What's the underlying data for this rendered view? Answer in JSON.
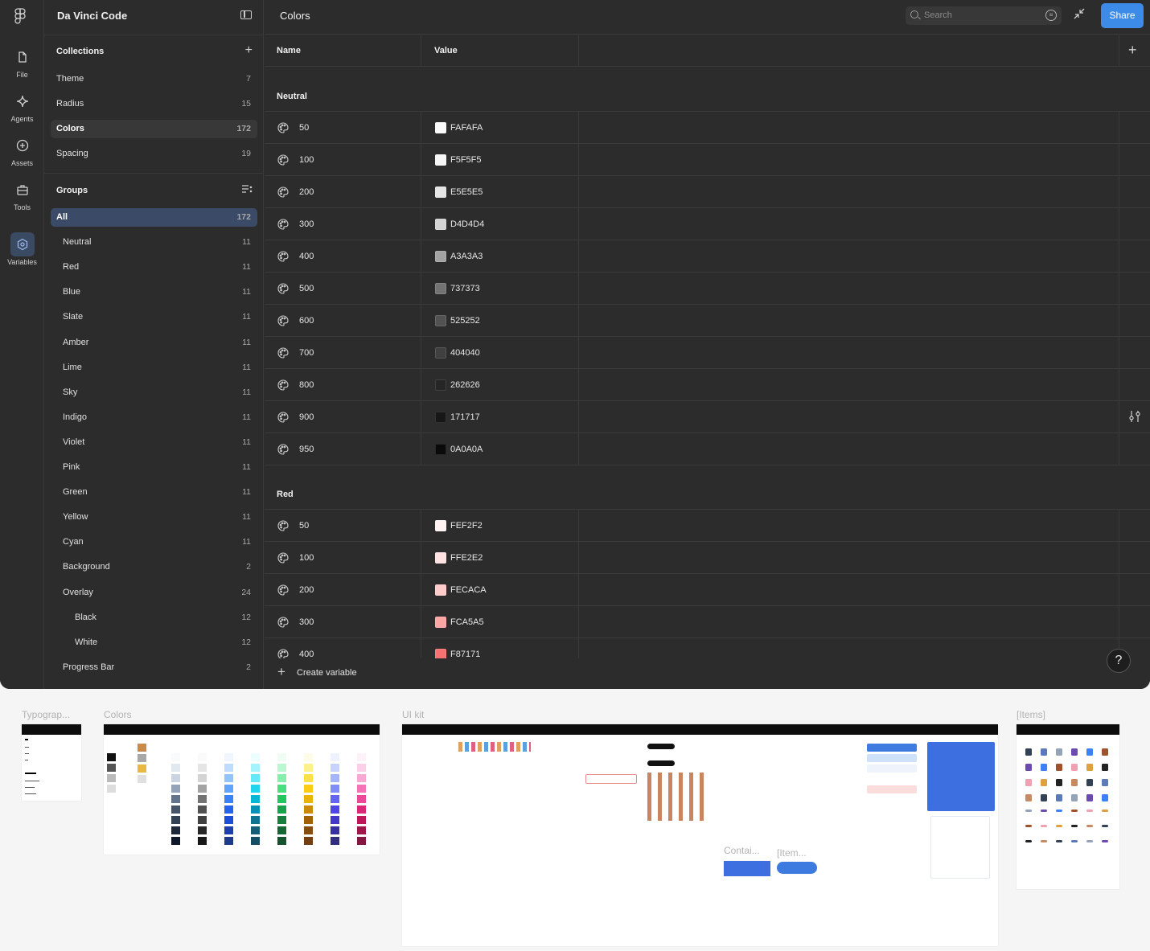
{
  "app": {
    "title": "Da Vinci Code"
  },
  "rail": {
    "items": [
      {
        "label": "File",
        "icon": "file-icon"
      },
      {
        "label": "Agents",
        "icon": "agents-icon"
      },
      {
        "label": "Assets",
        "icon": "plus-circle-icon"
      },
      {
        "label": "Tools",
        "icon": "toolbox-icon"
      },
      {
        "label": "Variables",
        "icon": "variables-icon",
        "active": true
      }
    ]
  },
  "collections": {
    "header": "Collections",
    "items": [
      {
        "name": "Theme",
        "count": "7"
      },
      {
        "name": "Radius",
        "count": "15"
      },
      {
        "name": "Colors",
        "count": "172",
        "selected": true
      },
      {
        "name": "Spacing",
        "count": "19"
      }
    ]
  },
  "groups": {
    "header": "Groups",
    "items": [
      {
        "name": "All",
        "count": "172",
        "selected": true,
        "indent": 0
      },
      {
        "name": "Neutral",
        "count": "11",
        "indent": 1
      },
      {
        "name": "Red",
        "count": "11",
        "indent": 1
      },
      {
        "name": "Blue",
        "count": "11",
        "indent": 1
      },
      {
        "name": "Slate",
        "count": "11",
        "indent": 1
      },
      {
        "name": "Amber",
        "count": "11",
        "indent": 1
      },
      {
        "name": "Lime",
        "count": "11",
        "indent": 1
      },
      {
        "name": "Sky",
        "count": "11",
        "indent": 1
      },
      {
        "name": "Indigo",
        "count": "11",
        "indent": 1
      },
      {
        "name": "Violet",
        "count": "11",
        "indent": 1
      },
      {
        "name": "Pink",
        "count": "11",
        "indent": 1
      },
      {
        "name": "Green",
        "count": "11",
        "indent": 1
      },
      {
        "name": "Yellow",
        "count": "11",
        "indent": 1
      },
      {
        "name": "Cyan",
        "count": "11",
        "indent": 1
      },
      {
        "name": "Background",
        "count": "2",
        "indent": 1
      },
      {
        "name": "Overlay",
        "count": "24",
        "indent": 1
      },
      {
        "name": "Black",
        "count": "12",
        "indent": 2
      },
      {
        "name": "White",
        "count": "12",
        "indent": 2
      },
      {
        "name": "Progress Bar",
        "count": "2",
        "indent": 1
      }
    ]
  },
  "main": {
    "title": "Colors",
    "search_placeholder": "Search",
    "share_label": "Share",
    "columns": {
      "name": "Name",
      "value": "Value"
    },
    "create_label": "Create variable",
    "help_label": "?"
  },
  "variable_groups": [
    {
      "name": "Neutral",
      "rows": [
        {
          "name": "50",
          "value": "FAFAFA",
          "color": "#FAFAFA"
        },
        {
          "name": "100",
          "value": "F5F5F5",
          "color": "#F5F5F5"
        },
        {
          "name": "200",
          "value": "E5E5E5",
          "color": "#E5E5E5"
        },
        {
          "name": "300",
          "value": "D4D4D4",
          "color": "#D4D4D4"
        },
        {
          "name": "400",
          "value": "A3A3A3",
          "color": "#A3A3A3"
        },
        {
          "name": "500",
          "value": "737373",
          "color": "#737373"
        },
        {
          "name": "600",
          "value": "525252",
          "color": "#525252"
        },
        {
          "name": "700",
          "value": "404040",
          "color": "#404040"
        },
        {
          "name": "800",
          "value": "262626",
          "color": "#262626"
        },
        {
          "name": "900",
          "value": "171717",
          "color": "#171717"
        },
        {
          "name": "950",
          "value": "0A0A0A",
          "color": "#0A0A0A"
        }
      ]
    },
    {
      "name": "Red",
      "rows": [
        {
          "name": "50",
          "value": "FEF2F2",
          "color": "#FEF2F2"
        },
        {
          "name": "100",
          "value": "FFE2E2",
          "color": "#FFE2E2"
        },
        {
          "name": "200",
          "value": "FECACA",
          "color": "#FECACA"
        },
        {
          "name": "300",
          "value": "FCA5A5",
          "color": "#FCA5A5"
        },
        {
          "name": "400",
          "value": "F87171",
          "color": "#F87171"
        }
      ]
    }
  ],
  "canvas": {
    "frames": [
      {
        "label": "Typograp..."
      },
      {
        "label": "Colors"
      },
      {
        "label": "UI kit"
      },
      {
        "label": "Contai..."
      },
      {
        "label": "[Item..."
      },
      {
        "label": "[Items]"
      }
    ]
  },
  "colors": {
    "accent": "#3d8be8",
    "panel": "#2c2c2c",
    "border": "#3a3a3a"
  }
}
